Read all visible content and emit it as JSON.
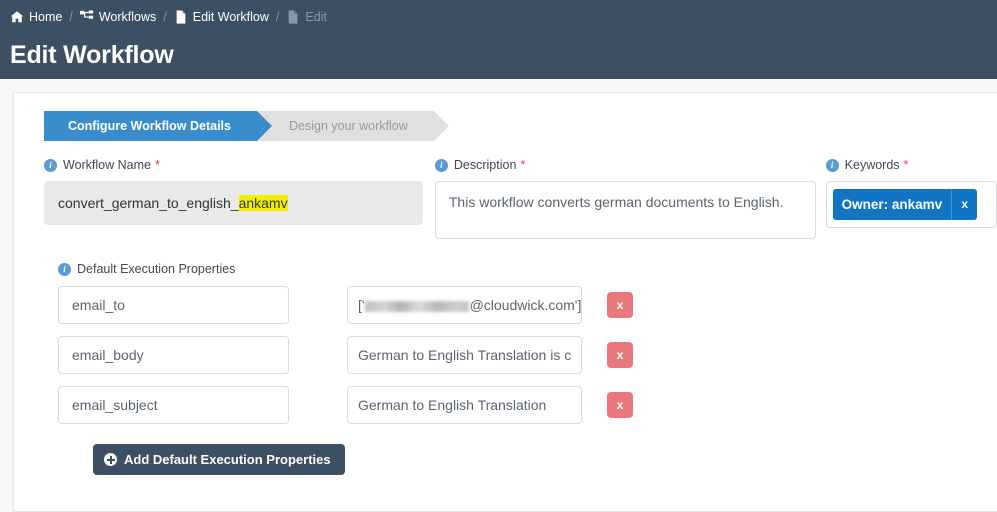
{
  "header": {
    "title": "Edit Workflow",
    "breadcrumb": [
      {
        "label": "Home",
        "icon": "home-icon",
        "active": true
      },
      {
        "label": "Workflows",
        "icon": "sitemap-icon",
        "active": true
      },
      {
        "label": "Edit Workflow",
        "icon": "file-icon",
        "active": true
      },
      {
        "label": "Edit",
        "icon": "file-icon",
        "active": false
      }
    ],
    "separator": "/"
  },
  "wizard": {
    "steps": [
      {
        "label": "Configure Workflow Details",
        "state": "active"
      },
      {
        "label": "Design your workflow",
        "state": "inactive"
      }
    ]
  },
  "form": {
    "workflow_name": {
      "label": "Workflow Name",
      "required_marker": "*",
      "value_prefix": "convert_german_to_english_",
      "value_highlight": "ankamv",
      "disabled": true
    },
    "description": {
      "label": "Description",
      "required_marker": "*",
      "value": "This workflow converts german documents to English."
    },
    "keywords": {
      "label": "Keywords",
      "required_marker": "*",
      "tags": [
        {
          "label": "Owner: ankamv",
          "remove": "x"
        }
      ]
    }
  },
  "properties": {
    "label": "Default Execution Properties",
    "rows": [
      {
        "key": "email_to",
        "value_prefix": "['",
        "value_redacted": true,
        "value_suffix": "@cloudwick.com']",
        "delete": "x"
      },
      {
        "key": "email_body",
        "value_prefix": "German to English Translation is c",
        "value_redacted": false,
        "value_suffix": "",
        "delete": "x"
      },
      {
        "key": "email_subject",
        "value_prefix": "German to English Translation",
        "value_redacted": false,
        "value_suffix": "",
        "delete": "x"
      }
    ],
    "add_button": "Add Default Execution Properties"
  },
  "colors": {
    "header_bg": "#3c4f63",
    "accent_blue": "#3a8dcc",
    "tag_blue": "#1275c4",
    "delete_red": "#e9797c",
    "required_red": "#e4423c",
    "highlight_yellow": "#f5f000"
  }
}
